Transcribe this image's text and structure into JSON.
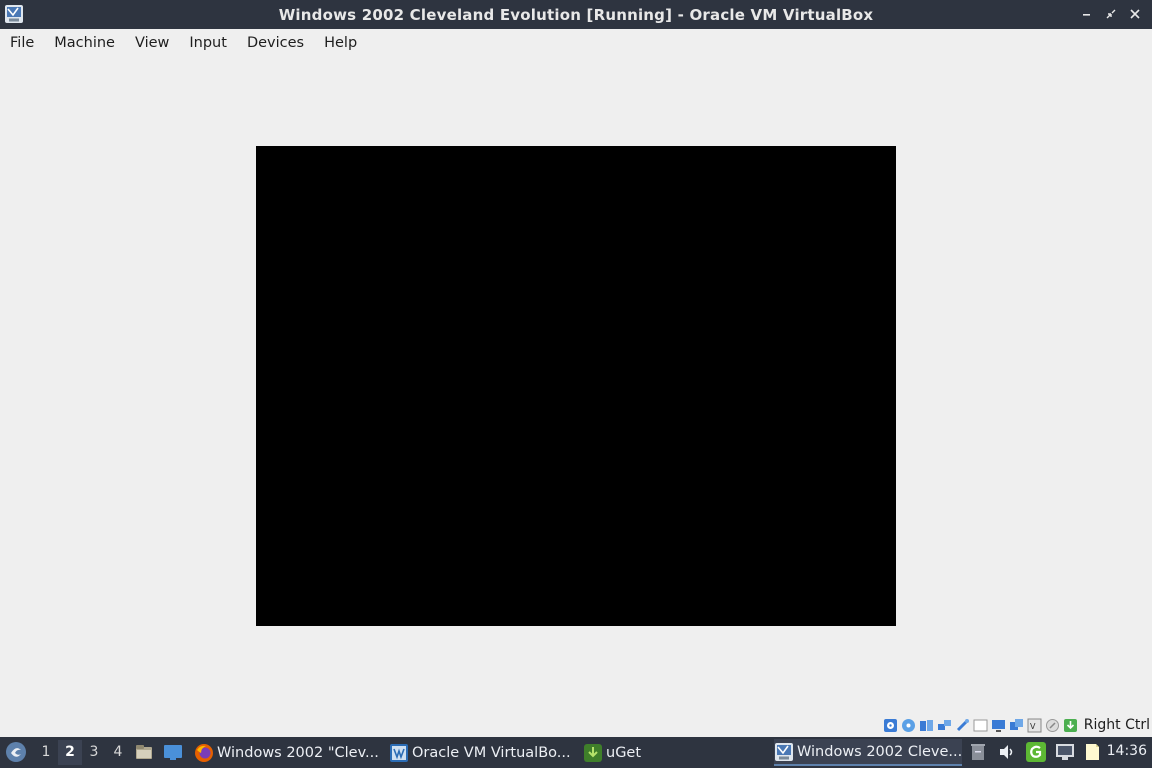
{
  "window": {
    "title": "Windows 2002 Cleveland Evolution [Running] - Oracle VM VirtualBox",
    "app_icon": "virtualbox-vm-icon",
    "controls": [
      "minimize",
      "restore",
      "close"
    ]
  },
  "menubar": {
    "items": [
      "File",
      "Machine",
      "View",
      "Input",
      "Devices",
      "Help"
    ]
  },
  "vm": {
    "screen_color": "#000000"
  },
  "statusbar": {
    "icons": [
      "hard-disk-icon",
      "optical-drive-icon",
      "audio-icon",
      "network-icon",
      "usb-icon",
      "shared-folders-icon",
      "display-icon",
      "video-capture-icon",
      "virtualization-icon",
      "mouse-integration-icon",
      "keyboard-icon"
    ],
    "host_key": "Right Ctrl"
  },
  "taskbar": {
    "desktops": [
      "1",
      "2",
      "3",
      "4"
    ],
    "active_desktop": "2",
    "tasks": [
      {
        "label": "Windows 2002 \"Clev...",
        "icon": "firefox-icon"
      },
      {
        "label": "Oracle VM VirtualBo...",
        "icon": "virtualbox-icon"
      },
      {
        "label": "uGet",
        "icon": "uget-icon"
      },
      {
        "label": "Windows 2002 Cleve...",
        "icon": "vm-window-icon",
        "active": true
      }
    ],
    "clock": "14:36"
  },
  "colors": {
    "titlebar": "#2e3440",
    "window_bg": "#efefef",
    "accent": "#5e81ac"
  }
}
